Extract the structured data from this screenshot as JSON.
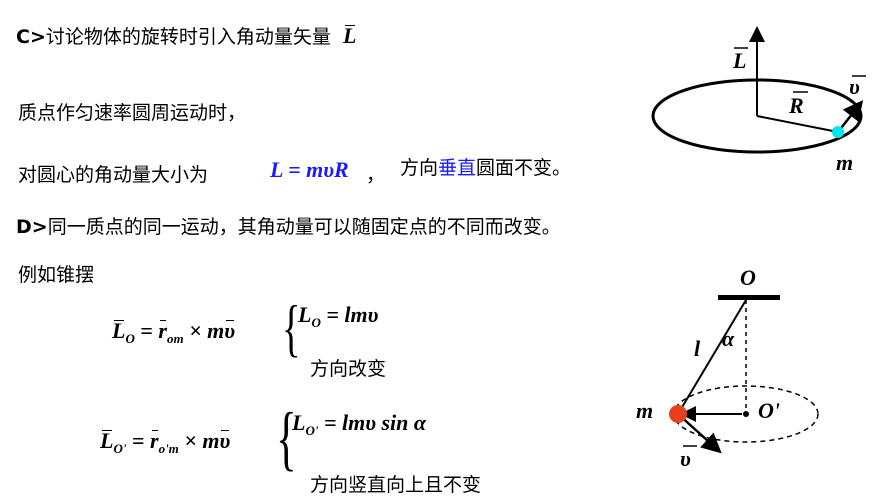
{
  "slide": {
    "line_c": {
      "prefix": "C>",
      "text": "讨论物体的旋转时引入角动量矢量",
      "symbol": "L"
    },
    "line_particle": "质点作匀速率圆周运动时，",
    "line_magnitude": {
      "text": "对圆心的角动量大小为",
      "formula": "L = mυR",
      "comma": "，",
      "dir_prefix": "方向",
      "dir_highlight": "垂直",
      "dir_suffix": "圆面不变。"
    },
    "line_d": {
      "prefix": "D>",
      "text": "同一质点的同一运动，其角动量可以随固定点的不同而改变。"
    },
    "example_label": "例如锥摆",
    "eq1": {
      "lhs_L": "L",
      "lhs_sub": "O",
      "eq": "=",
      "r": "r",
      "r_sub": "om",
      "cross": "× m",
      "v": "υ",
      "brace_mag_L": "L",
      "brace_mag_sub": "O",
      "brace_mag_rhs": "= lmυ",
      "brace_dir": "方向改变"
    },
    "eq2": {
      "lhs_L": "L",
      "lhs_sub": "O'",
      "eq": "=",
      "r": "r",
      "r_sub": "o'm",
      "cross": "× m",
      "v": "υ",
      "brace_mag_L": "L",
      "brace_mag_sub": "O'",
      "brace_mag_rhs": "= lmυ sin α",
      "brace_dir": "方向竖直向上且不变"
    }
  },
  "diagram_circle": {
    "L": "L",
    "R": "R",
    "v": "υ",
    "m": "m"
  },
  "diagram_pendulum": {
    "O": "O",
    "l": "l",
    "alpha": "α",
    "m": "m",
    "O_prime": "O'",
    "v": "υ"
  }
}
